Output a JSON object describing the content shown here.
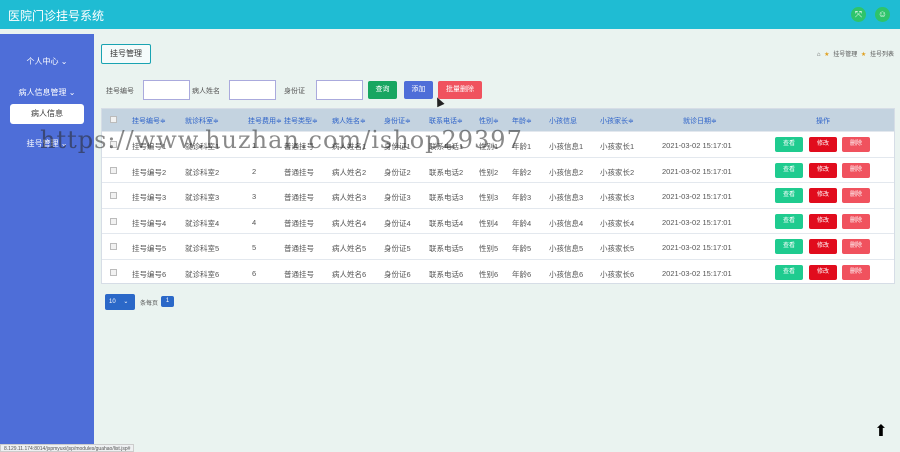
{
  "app": {
    "title": "医院门诊挂号系统"
  },
  "topbar": {
    "icon1": "⤧",
    "icon2": "☺"
  },
  "sidebar": {
    "items": [
      {
        "label": "个人中心",
        "caret": "⌄"
      },
      {
        "label": "病人信息管理",
        "caret": "⌄"
      },
      {
        "label": "挂号管理",
        "caret": "⌄"
      }
    ],
    "active_sub": "病人信息"
  },
  "page": {
    "tag": "挂号管理",
    "breadcrumb": {
      "home_icon": "⌂",
      "sep_icon": "★",
      "level1": "挂号管理",
      "level2": "挂号列表"
    }
  },
  "search": {
    "fields": [
      {
        "label": "挂号编号",
        "value": ""
      },
      {
        "label": "病人姓名",
        "value": ""
      },
      {
        "label": "身份证",
        "value": ""
      }
    ],
    "query_label": "查询",
    "add_label": "添加",
    "batch_delete_label": "批量删除"
  },
  "table": {
    "headers": [
      "挂号编号≑",
      "就诊科室≑",
      "挂号费用≑",
      "挂号类型≑",
      "病人姓名≑",
      "身份证≑",
      "联系电话≑",
      "性别≑",
      "年龄≑",
      "小孩信息",
      "小孩家长≑",
      "就诊日期≑",
      "操作"
    ],
    "rows": [
      [
        "挂号编号1",
        "就诊科室1",
        "1",
        "普通挂号",
        "病人姓名1",
        "身份证1",
        "联系电话1",
        "性别1",
        "年龄1",
        "小孩信息1",
        "小孩家长1",
        "2021-03-02 15:17:01"
      ],
      [
        "挂号编号2",
        "就诊科室2",
        "2",
        "普通挂号",
        "病人姓名2",
        "身份证2",
        "联系电话2",
        "性别2",
        "年龄2",
        "小孩信息2",
        "小孩家长2",
        "2021-03-02 15:17:01"
      ],
      [
        "挂号编号3",
        "就诊科室3",
        "3",
        "普通挂号",
        "病人姓名3",
        "身份证3",
        "联系电话3",
        "性别3",
        "年龄3",
        "小孩信息3",
        "小孩家长3",
        "2021-03-02 15:17:01"
      ],
      [
        "挂号编号4",
        "就诊科室4",
        "4",
        "普通挂号",
        "病人姓名4",
        "身份证4",
        "联系电话4",
        "性别4",
        "年龄4",
        "小孩信息4",
        "小孩家长4",
        "2021-03-02 15:17:01"
      ],
      [
        "挂号编号5",
        "就诊科室5",
        "5",
        "普通挂号",
        "病人姓名5",
        "身份证5",
        "联系电话5",
        "性别5",
        "年龄5",
        "小孩信息5",
        "小孩家长5",
        "2021-03-02 15:17:01"
      ],
      [
        "挂号编号6",
        "就诊科室6",
        "6",
        "普通挂号",
        "病人姓名6",
        "身份证6",
        "联系电话6",
        "性别6",
        "年龄6",
        "小孩信息6",
        "小孩家长6",
        "2021-03-02 15:17:01"
      ]
    ],
    "actions": {
      "view": "查看",
      "edit": "修改",
      "delete": "删除"
    }
  },
  "pager": {
    "page_size": "10",
    "page_size_caret": "⌄",
    "label": "条每页",
    "current": "1"
  },
  "statusbar": {
    "url": "8.129.11.174:8014/jspmyuxi/jsp/modules/guahao/list.jsp#"
  },
  "watermark": {
    "text": "https://www.huzhan.com/ishop29397"
  },
  "totop": {
    "icon": "⬆"
  },
  "colors": {
    "topbar": "#1fbcd3",
    "sidebar": "#4e6ed8",
    "view": "#1fcb8f",
    "edit": "#e10c1d",
    "delete": "#f0525e",
    "query": "#18a661",
    "add": "#4e6ed8"
  }
}
